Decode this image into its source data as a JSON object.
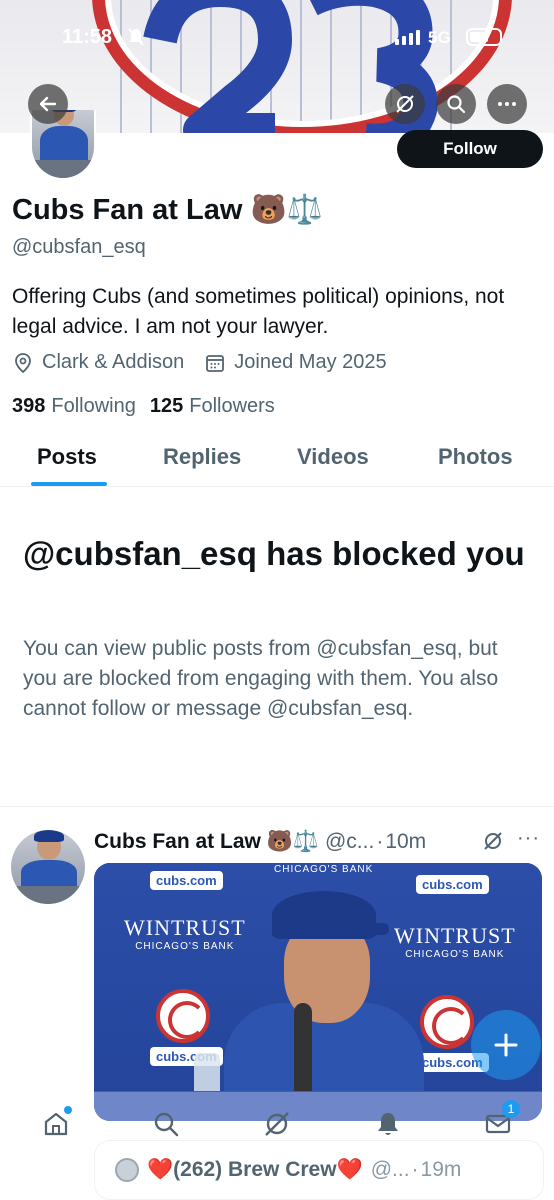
{
  "status_bar": {
    "time": "11:58",
    "network": "5G"
  },
  "profile": {
    "display_name": "Cubs Fan at Law 🐻⚖️",
    "handle": "@cubsfan_esq",
    "bio": "Offering Cubs (and sometimes political) opinions, not legal advice. I am not your lawyer.",
    "location": "Clark & Addison",
    "joined": "Joined May 2025",
    "following_count": "398",
    "following_label": "Following",
    "followers_count": "125",
    "followers_label": "Followers",
    "follow_button": "Follow"
  },
  "tabs": [
    {
      "label": "Posts",
      "active": true
    },
    {
      "label": "Replies",
      "active": false
    },
    {
      "label": "Videos",
      "active": false
    },
    {
      "label": "Photos",
      "active": false
    }
  ],
  "blocked": {
    "title": "@cubsfan_esq has blocked you",
    "text": "You can view public posts from @cubsfan_esq, but you are blocked from engaging with them. You also cannot follow or message @cubsfan_esq."
  },
  "post": {
    "name": "Cubs Fan at Law 🐻⚖️",
    "handle": "@c...",
    "sep": "·",
    "time": "10m",
    "media_text": {
      "cubs_com": "cubs.com",
      "wintrust": "WINTRUST",
      "wintrust_sub": "CHICAGO'S BANK",
      "chicago_bank_top": "CHICAGO'S BANK"
    }
  },
  "next_post": {
    "name": "❤️(262) Brew Crew❤️",
    "handle": "@...",
    "sep": "·",
    "time": "19m"
  },
  "nav": {
    "messages_badge": "1"
  },
  "colors": {
    "accent": "#1d9bf0",
    "text": "#0f1419",
    "secondary": "#536471"
  }
}
